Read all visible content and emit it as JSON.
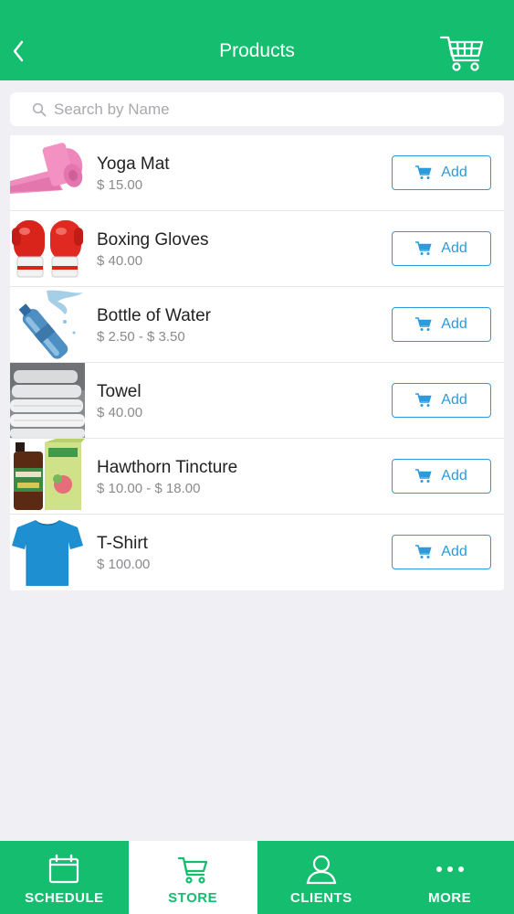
{
  "header": {
    "title": "Products",
    "back_icon": "chevron-left-icon",
    "cart_icon": "shopping-cart-icon"
  },
  "search": {
    "placeholder": "Search by Name",
    "value": ""
  },
  "products": [
    {
      "name": "Yoga Mat",
      "price": "$ 15.00",
      "add_label": "Add",
      "image": "yoga-mat"
    },
    {
      "name": "Boxing Gloves",
      "price": "$ 40.00",
      "add_label": "Add",
      "image": "boxing-gloves"
    },
    {
      "name": "Bottle of Water",
      "price": "$ 2.50 - $ 3.50",
      "add_label": "Add",
      "image": "water-bottle"
    },
    {
      "name": "Towel",
      "price": "$ 40.00",
      "add_label": "Add",
      "image": "towels"
    },
    {
      "name": "Hawthorn Tincture",
      "price": "$ 10.00 - $ 18.00",
      "add_label": "Add",
      "image": "tincture"
    },
    {
      "name": "T-Shirt",
      "price": "$ 100.00",
      "add_label": "Add",
      "image": "t-shirt"
    }
  ],
  "tabs": [
    {
      "label": "SCHEDULE",
      "icon": "calendar-icon",
      "active": false
    },
    {
      "label": "STORE",
      "icon": "cart-icon",
      "active": true
    },
    {
      "label": "CLIENTS",
      "icon": "person-icon",
      "active": false
    },
    {
      "label": "MORE",
      "icon": "more-dots-icon",
      "active": false
    }
  ],
  "colors": {
    "primary": "#15bd6f",
    "accent": "#2b9bdb",
    "background": "#efeff4"
  }
}
